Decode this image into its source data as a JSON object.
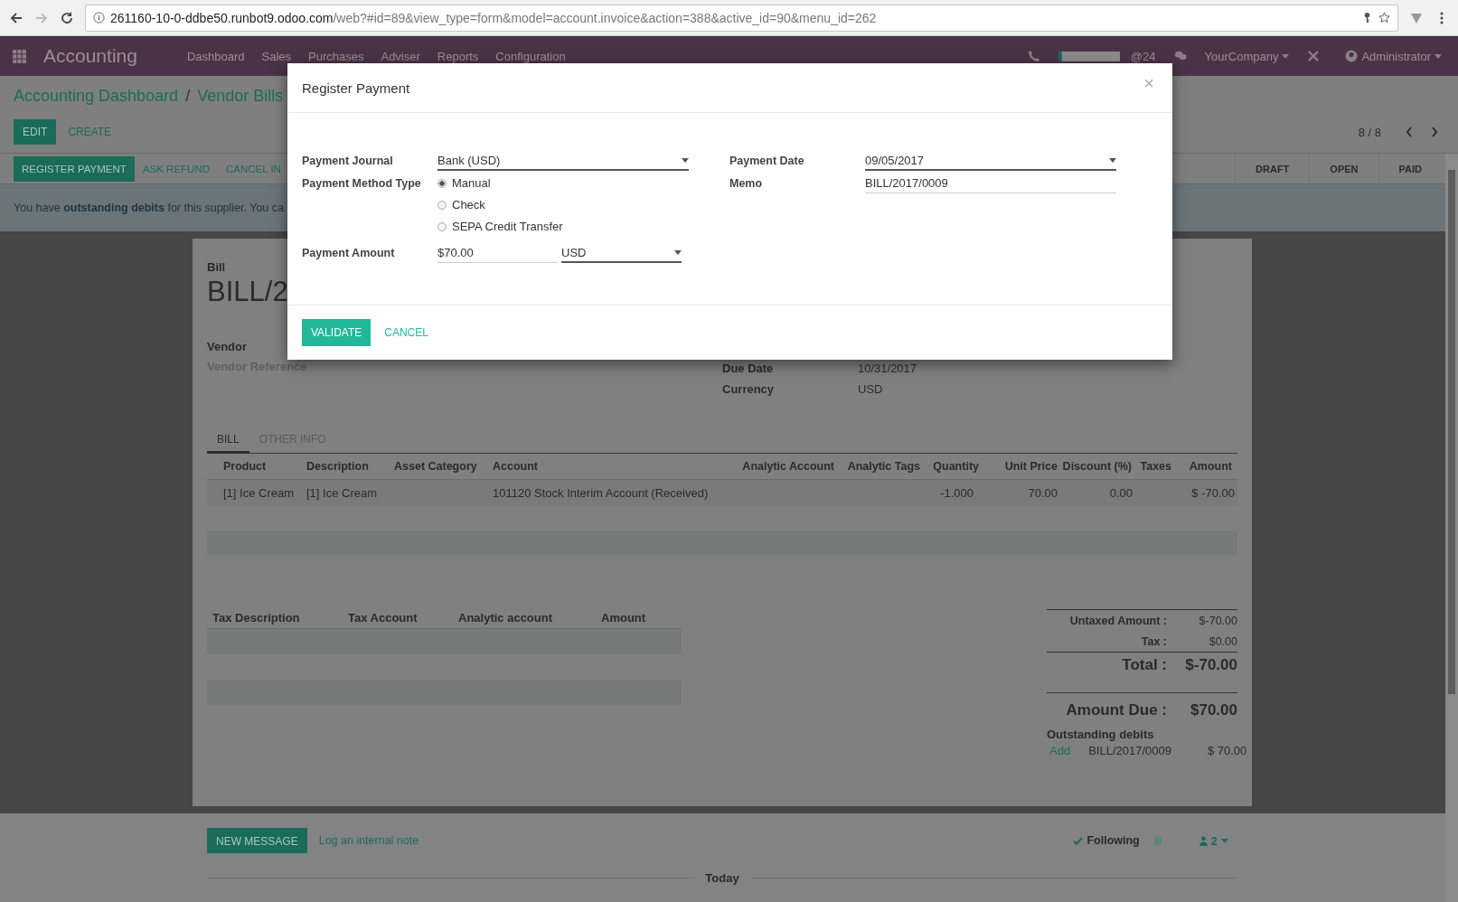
{
  "browser": {
    "url_host": "261160-10-0-ddbe50.runbot9.odoo.com",
    "url_path": "/web?#id=89&view_type=form&model=account.invoice&action=388&active_id=90&menu_id=262"
  },
  "navbar": {
    "meter": {
      "level": 0.06
    },
    "app": "Accounting",
    "menu": [
      "Dashboard",
      "Sales",
      "Purchases",
      "Adviser",
      "Reports",
      "Configuration"
    ],
    "mentions": "@24",
    "company": "YourCompany",
    "user": "Administrator"
  },
  "breadcrumb": {
    "items": [
      "Accounting Dashboard",
      "Vendor Bills"
    ],
    "separator": "/"
  },
  "buttons": {
    "primary": "EDIT",
    "secondary": "CREATE"
  },
  "pager": "8 / 8",
  "actions": [
    {
      "label": "REGISTER PAYMENT",
      "kind": "primary"
    },
    {
      "label": "ASK REFUND",
      "kind": "link"
    },
    {
      "label": "CANCEL IN",
      "kind": "link"
    }
  ],
  "statuses": [
    "DRAFT",
    "OPEN",
    "PAID"
  ],
  "alert": "You have **outstanding debits** for this supplier. You ca",
  "sheet": {
    "caption": "Bill",
    "number": "BILL/2",
    "vendor_label": "Vendor",
    "vendor_reference_placeholder": "Vendor Reference",
    "fields": [
      {
        "label": "Due Date",
        "value": "10/31/2017"
      },
      {
        "label": "Currency",
        "value": "USD"
      }
    ]
  },
  "tabs": [
    {
      "label": "BILL",
      "selected": true
    },
    {
      "label": "OTHER INFO",
      "selected": false
    }
  ],
  "lines": {
    "columns": [
      "Product",
      "Description",
      "Asset Category",
      "Account",
      "Analytic Account",
      "Analytic Tags",
      "Quantity",
      "Unit Price",
      "Discount (%)",
      "Taxes",
      "Amount"
    ],
    "rows": [
      [
        "[1] Ice Cream",
        "[1] Ice Cream",
        "",
        "101120 Stock Interim Account (Received)",
        "",
        "",
        "-1.000",
        "70.00",
        "0.00",
        "",
        "$ -70.00"
      ]
    ]
  },
  "taxes": {
    "columns": [
      "Tax Description",
      "Tax Account",
      "Analytic account",
      "Amount"
    ]
  },
  "totals": [
    {
      "label": "Untaxed Amount :",
      "value": "$-70.00",
      "kind": "sub"
    },
    {
      "label": "Tax :",
      "value": "$0.00",
      "kind": "sub"
    },
    {
      "label": "Total :",
      "value": "$-70.00",
      "kind": "total"
    },
    {
      "label": "Amount Due :",
      "value": "$70.00",
      "kind": "due"
    }
  ],
  "outstanding": {
    "title": "Outstanding debits",
    "items": [
      {
        "action": "Add",
        "reference": "BILL/2017/0009",
        "amount": "$ 70.00"
      }
    ]
  },
  "chatter": {
    "new_message": "NEW MESSAGE",
    "log_note": "Log an internal note",
    "following": "Following",
    "followers": "2",
    "date_separator": "Today"
  },
  "modal": {
    "title": "Register Payment",
    "close": "×",
    "journal_label": "Payment Journal",
    "journal": "Bank (USD)",
    "method_label": "Payment Method Type",
    "method_options": [
      {
        "label": "Manual",
        "selected": true
      },
      {
        "label": "Check",
        "selected": false
      },
      {
        "label": "SEPA Credit Transfer",
        "selected": false
      }
    ],
    "amount_label": "Payment Amount",
    "amount": "$70.00",
    "currency": "USD",
    "date_label": "Payment Date",
    "date": "09/05/2017",
    "memo_label": "Memo",
    "memo": "BILL/2017/0009",
    "validate": "VALIDATE",
    "cancel": "CANCEL"
  }
}
